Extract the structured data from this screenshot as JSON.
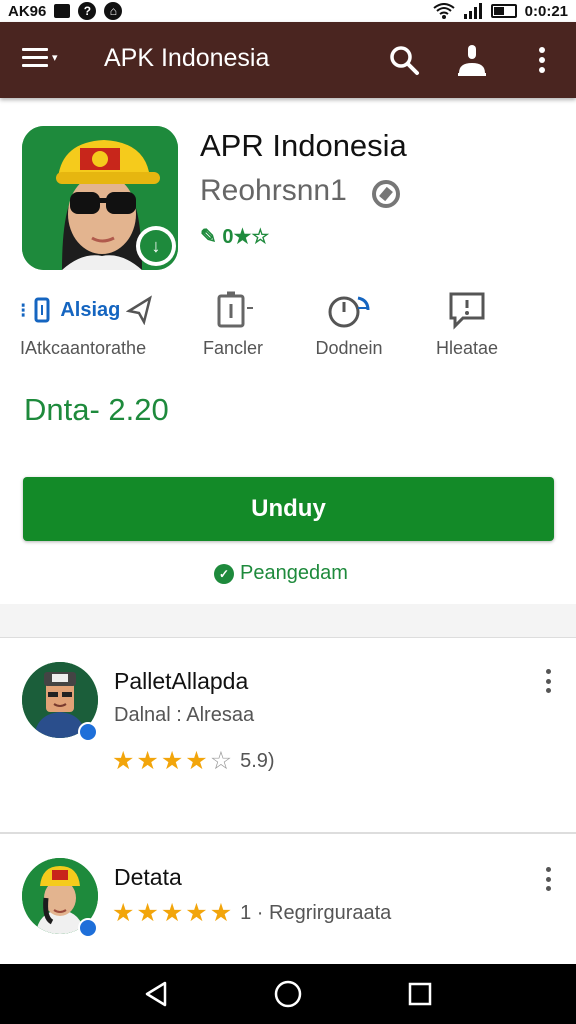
{
  "status_bar": {
    "left_text": "AK96",
    "time": "0:0:21"
  },
  "app_bar": {
    "title": "APK Indonesia"
  },
  "app": {
    "name": "APR Indonesia",
    "developer": "Reohrsnn1",
    "rating_text": "0★☆"
  },
  "stats": [
    {
      "top": "Alsiag",
      "label": "IAtkcaantorathe"
    },
    {
      "label": "Fancler"
    },
    {
      "label": "Dodnein"
    },
    {
      "label": "Hleatae"
    }
  ],
  "version_text": "Dnta- 2.20",
  "download_label": "Unduy",
  "verified_label": "Peangedam",
  "reviews": [
    {
      "name": "PalletAllapda",
      "subtitle": "Dalnal : Alresaa",
      "rating": 4.5,
      "rating_text": "5.9)"
    },
    {
      "name": "Detata",
      "subtitle": "",
      "rating": 5,
      "rating_text": "1 · Regrirguraata"
    }
  ],
  "colors": {
    "app_bar": "#4a2520",
    "accent_green": "#138a28",
    "star": "#f2a50b",
    "link_blue": "#1565c0"
  }
}
